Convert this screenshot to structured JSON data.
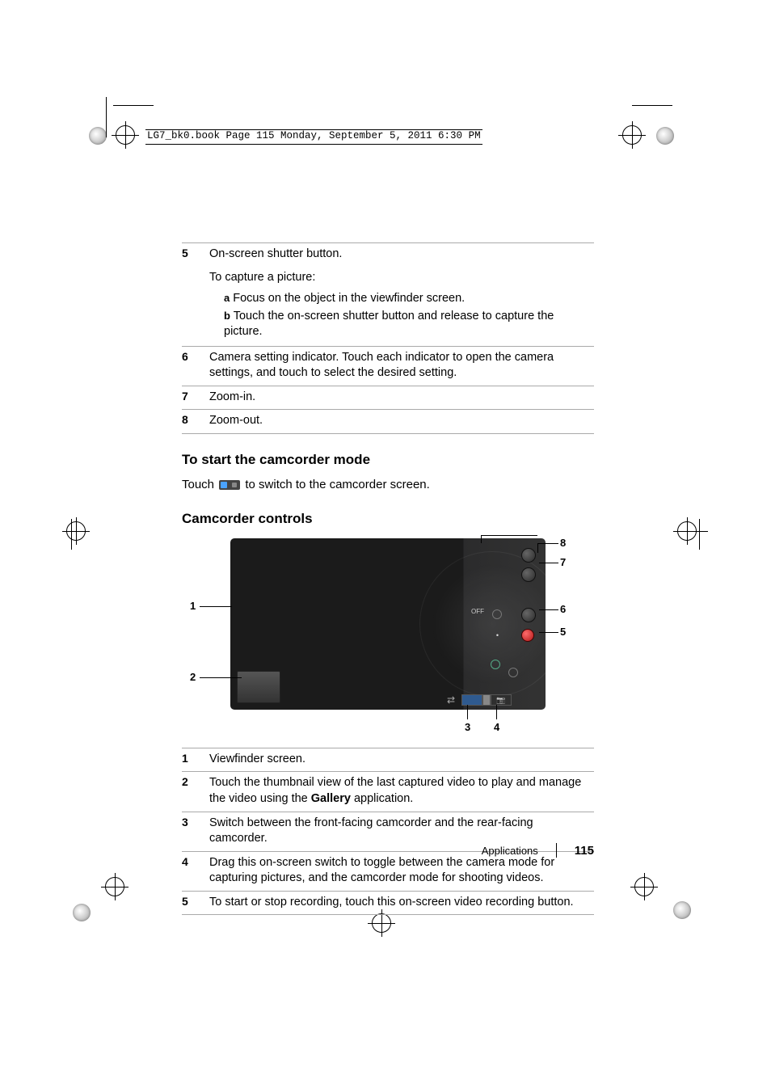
{
  "book_header": "LG7_bk0.book  Page 115  Monday, September 5, 2011  6:30 PM",
  "top_table": [
    {
      "num": "5",
      "lines": [
        "On-screen shutter button."
      ],
      "extra": "To capture a picture:",
      "sub": [
        {
          "l": "a",
          "t": "Focus on the object in the viewfinder screen."
        },
        {
          "l": "b",
          "t": "Touch the on-screen shutter button and release to capture the picture."
        }
      ]
    },
    {
      "num": "6",
      "lines": [
        "Camera setting indicator. Touch each indicator to open the camera settings, and touch to select the desired setting."
      ]
    },
    {
      "num": "7",
      "lines": [
        "Zoom-in."
      ]
    },
    {
      "num": "8",
      "lines": [
        "Zoom-out."
      ]
    }
  ],
  "section1_title": "To start the camcorder mode",
  "section1_body_pre": "Touch ",
  "section1_body_post": " to switch to the camcorder screen.",
  "section2_title": "Camcorder controls",
  "callouts": {
    "1": "1",
    "2": "2",
    "3": "3",
    "4": "4",
    "5": "5",
    "6": "6",
    "7": "7",
    "8": "8"
  },
  "bottom_table": [
    {
      "num": "1",
      "lines": [
        "Viewfinder screen."
      ]
    },
    {
      "num": "2",
      "lines": [
        "Touch the thumbnail view of the last captured video to play and manage the video using the "
      ],
      "bold": "Gallery",
      "lines2": [
        " application."
      ]
    },
    {
      "num": "3",
      "lines": [
        "Switch between the front-facing camcorder and the rear-facing camcorder."
      ]
    },
    {
      "num": "4",
      "lines": [
        "Drag this on-screen switch to toggle between the camera mode for capturing pictures, and the camcorder mode for shooting videos."
      ]
    },
    {
      "num": "5",
      "lines": [
        "To start or stop recording, touch this on-screen video recording button."
      ]
    }
  ],
  "footer_label": "Applications",
  "footer_page": "115"
}
